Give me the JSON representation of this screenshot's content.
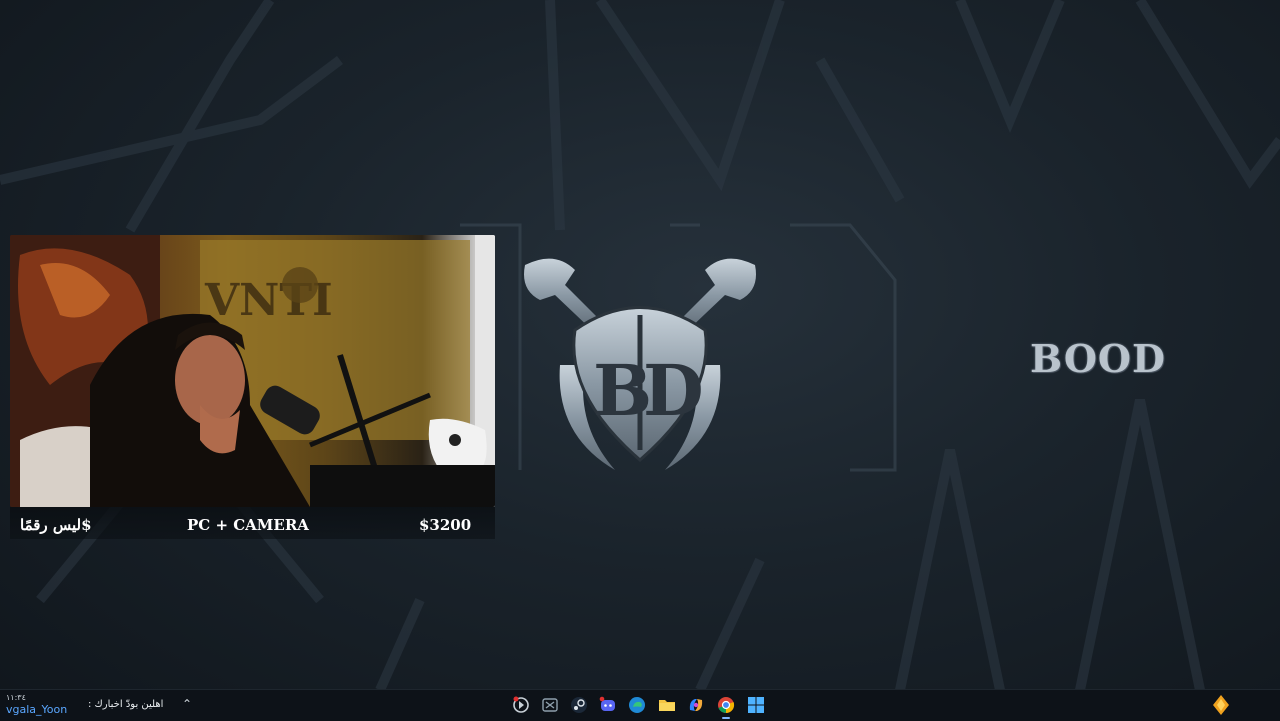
{
  "desktop": {
    "brand_text": "BOOD"
  },
  "webcam_overlay": {
    "left_label": "ليس رقمًا$",
    "center_label": "PC + CAMERA",
    "right_label": "$3200"
  },
  "taskbar": {
    "tray_time": "١١:٣٤",
    "tray_user": "vgala_Yoon",
    "news_text": "اهلين بودّ اخبارك :",
    "icons": [
      "media-player-icon",
      "xbox-icon",
      "steam-icon",
      "discord-icon",
      "edge-icon",
      "file-explorer-icon",
      "copilot-icon",
      "chrome-icon",
      "windows-start-icon"
    ],
    "notification_icon": "diamond-widget-icon"
  },
  "colors": {
    "background": "#1a232b",
    "brand_text": "#b9c3cc",
    "taskbar": "#0d1218",
    "accent": "#7fb6ff"
  }
}
